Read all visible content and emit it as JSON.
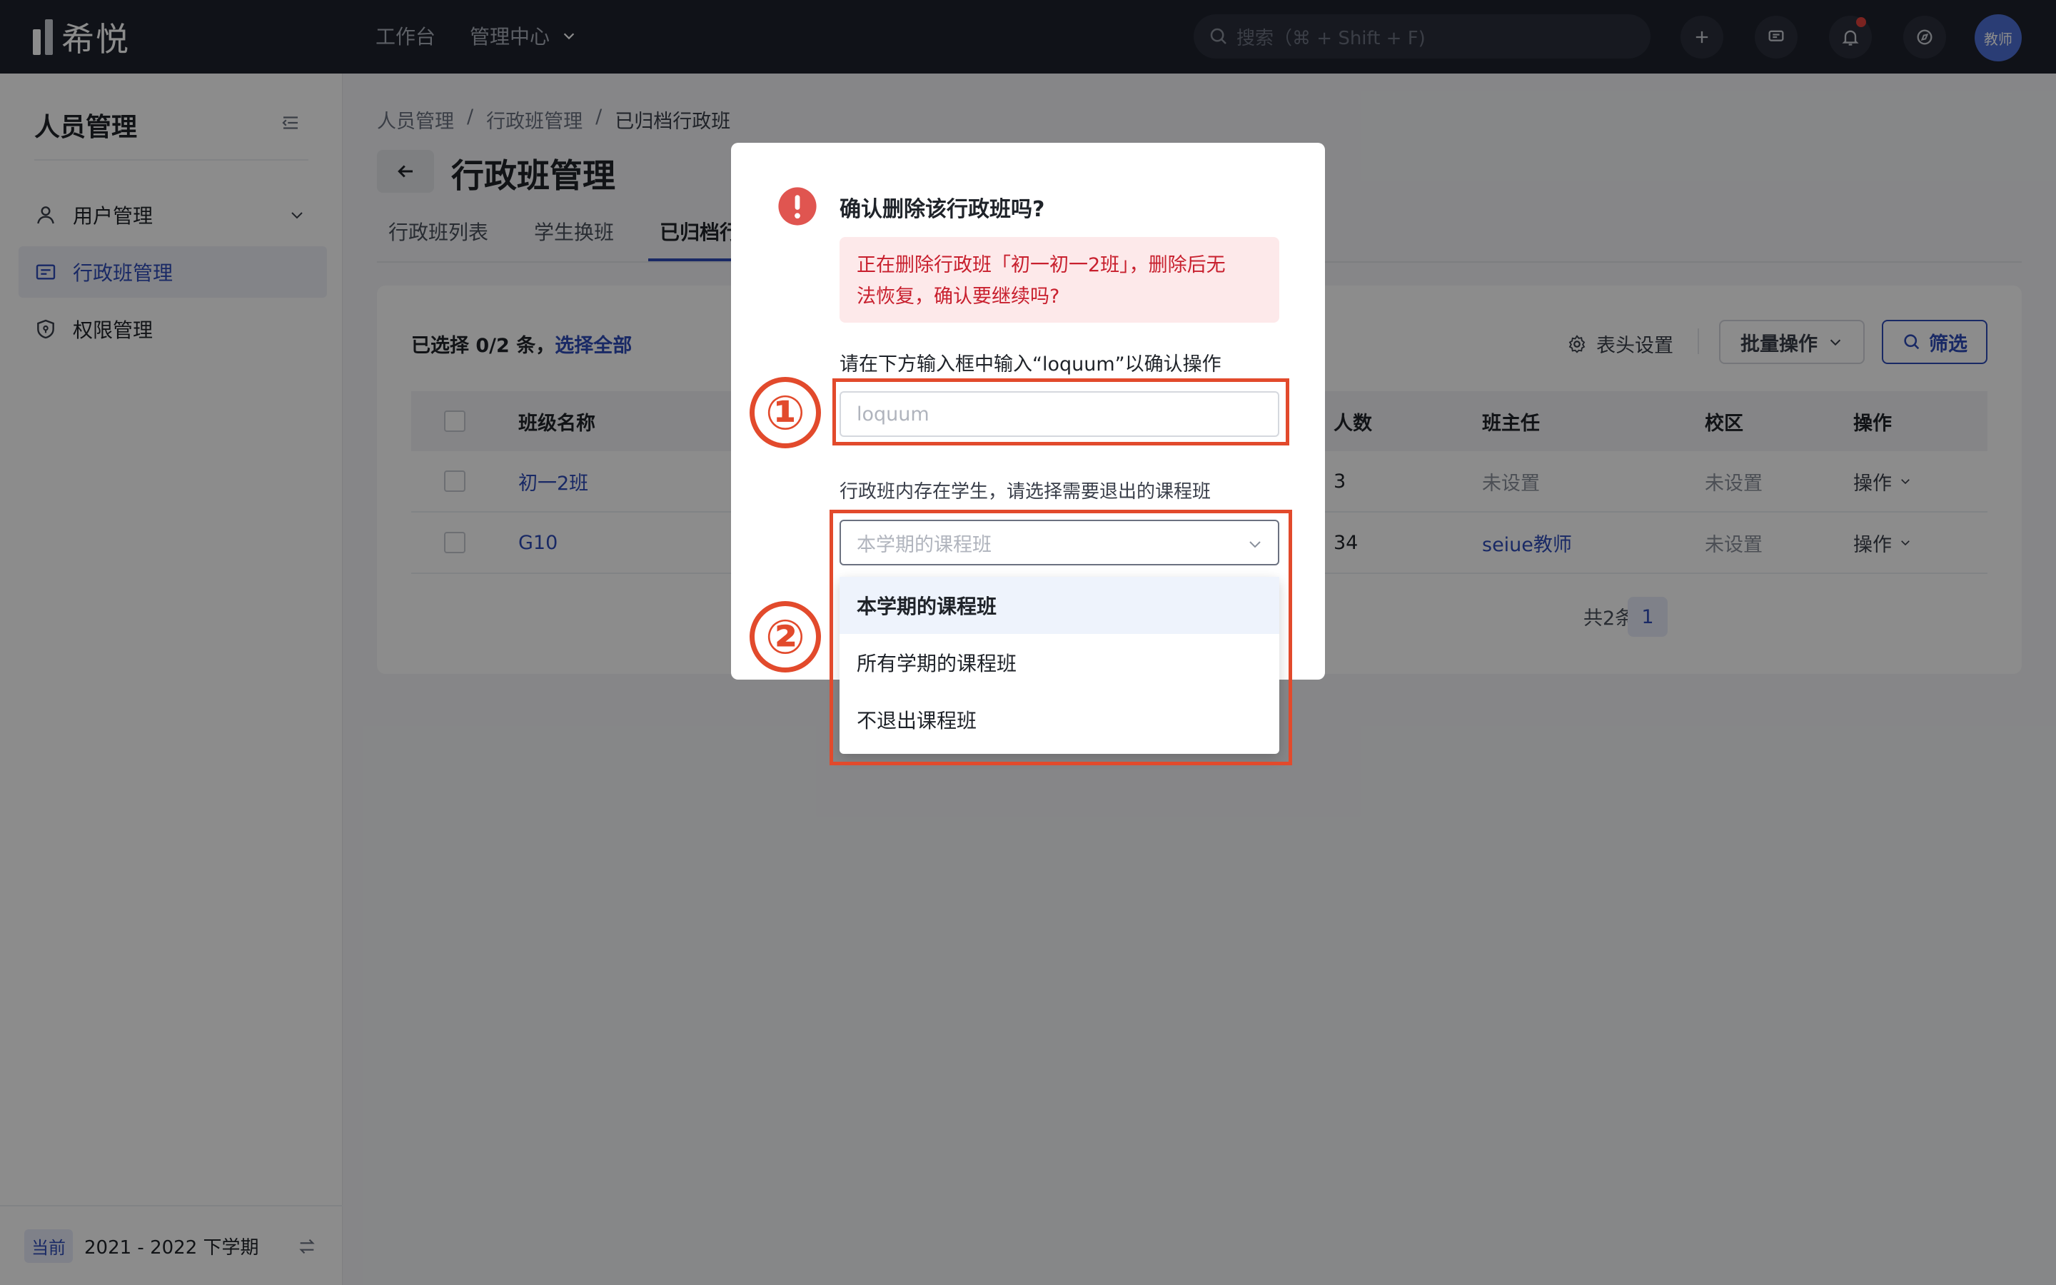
{
  "app": {
    "logo_text": "希悦",
    "avatar_text": "教师"
  },
  "topnav": {
    "workbench": "工作台",
    "admin_center": "管理中心"
  },
  "search": {
    "placeholder": "搜索（⌘ + Shift + F)"
  },
  "icons": {
    "add": "plus-icon",
    "message": "message-icon",
    "notification": "bell-icon",
    "help": "compass-icon"
  },
  "sidebar": {
    "title": "人员管理",
    "items": [
      {
        "label": "用户管理",
        "icon": "user-icon"
      },
      {
        "label": "行政班管理",
        "icon": "class-icon"
      },
      {
        "label": "权限管理",
        "icon": "shield-icon"
      }
    ],
    "footer": {
      "tag": "当前",
      "term": "2021 - 2022 下学期"
    }
  },
  "breadcrumb": [
    "人员管理",
    "/",
    "行政班管理",
    "/",
    "已归档行政班"
  ],
  "page": {
    "title": "行政班管理"
  },
  "tabs": [
    "行政班列表",
    "学生换班",
    "已归档行政班"
  ],
  "toolbar": {
    "selected_prefix": "已选择 0/2 条，",
    "select_all": "选择全部",
    "column_settings": "表头设置",
    "batch": "批量操作",
    "filter": "筛选"
  },
  "table": {
    "headers": {
      "name": "班级名称",
      "count": "人数",
      "teacher": "班主任",
      "campus": "校区",
      "ops": "操作"
    },
    "rows": [
      {
        "name": "初一2班",
        "count": "3",
        "teacher": "未设置",
        "campus": "未设置",
        "ops": "操作"
      },
      {
        "name": "G10",
        "count": "34",
        "teacher": "seiue教师",
        "campus": "未设置",
        "ops": "操作"
      }
    ]
  },
  "pagination": {
    "total": "共2条",
    "page": "1"
  },
  "modal": {
    "title": "确认删除该行政班吗?",
    "alert_line1": "正在删除行政班「初一初一2班」，删除后无",
    "alert_line2": "法恢复，确认要继续吗?",
    "confirm_label": "请在下方输入框中输入“loquum”以确认操作",
    "confirm_placeholder": "loquum",
    "select_label": "行政班内存在学生，请选择需要退出的课程班",
    "select_placeholder": "本学期的课程班",
    "options": [
      "本学期的课程班",
      "所有学期的课程班",
      "不退出课程班"
    ]
  },
  "annotations": {
    "one": "①",
    "two": "②"
  },
  "colors": {
    "accent": "#2f4cb8",
    "annotation": "#e24a2c",
    "danger": "#c8202e"
  }
}
